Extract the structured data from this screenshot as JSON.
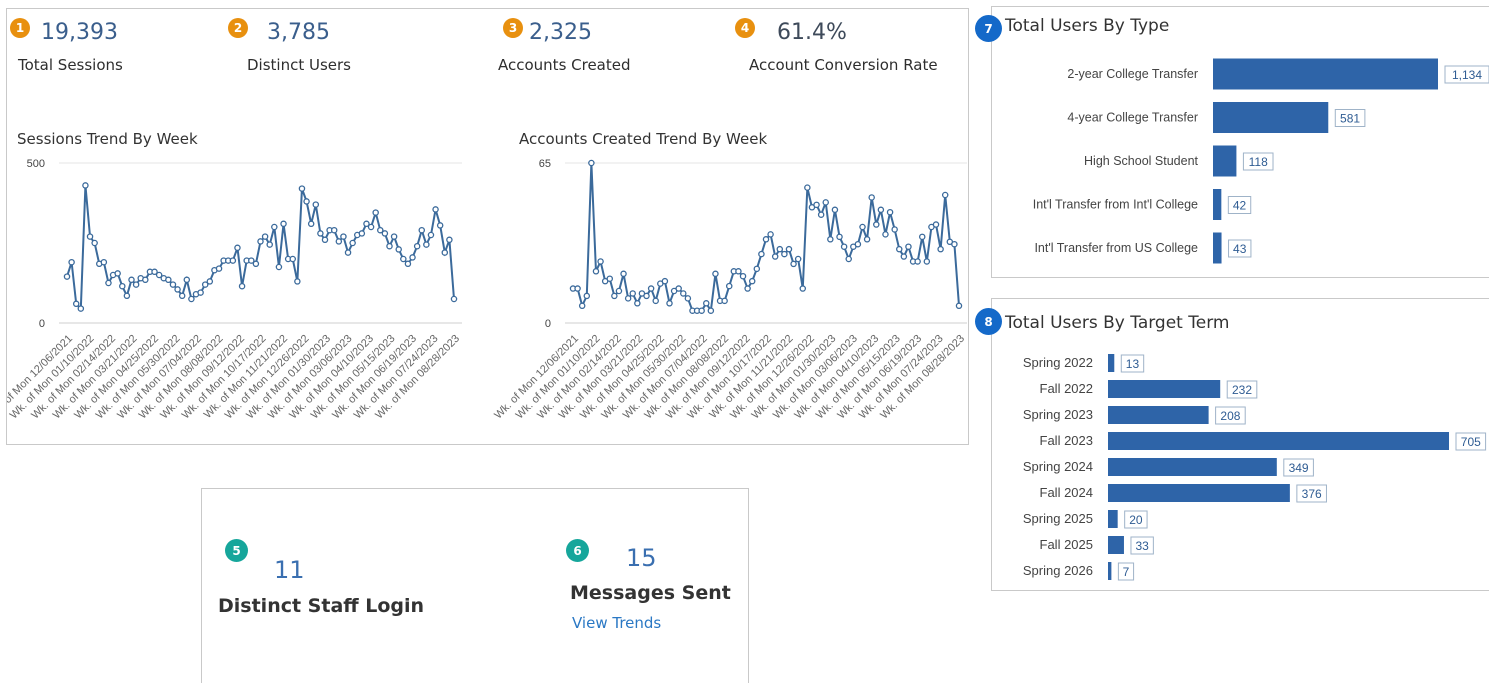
{
  "colors": {
    "accent_line": "#3b6a9b",
    "bar": "#2e64a8",
    "badge_orange": "#e8900f",
    "badge_teal": "#16a69b",
    "badge_blue": "#1469c9",
    "value_link": "#2a78c4"
  },
  "kpis": [
    {
      "badge": "1",
      "value": "19,393",
      "label": "Total Sessions"
    },
    {
      "badge": "2",
      "value": "3,785",
      "label": "Distinct Users"
    },
    {
      "badge": "3",
      "value": "2,325",
      "label": "Accounts Created"
    },
    {
      "badge": "4",
      "value": "61.4%",
      "label": "Account Conversion Rate"
    }
  ],
  "staff": {
    "login": {
      "badge": "5",
      "value": "11",
      "label": "Distinct Staff Login"
    },
    "messages": {
      "badge": "6",
      "value": "15",
      "label": "Messages Sent",
      "link": "View Trends"
    }
  },
  "users_by_type": {
    "badge": "7",
    "title": "Total Users By Type"
  },
  "users_by_term": {
    "badge": "8",
    "title": "Total Users By Target Term"
  },
  "chart_data": [
    {
      "type": "line",
      "title": "Sessions Trend By Week",
      "ylim": [
        0,
        500
      ],
      "yticks": [
        "500",
        "0"
      ],
      "xtick_labels": [
        "Wk. of Mon 12/06/2021",
        "Wk. of Mon 01/10/2022",
        "Wk. of Mon 02/14/2022",
        "Wk. of Mon 03/21/2022",
        "Wk. of Mon 04/25/2022",
        "Wk. of Mon 05/30/2022",
        "Wk. of Mon 07/04/2022",
        "Wk. of Mon 08/08/2022",
        "Wk. of Mon 09/12/2022",
        "Wk. of Mon 10/17/2022",
        "Wk. of Mon 11/21/2022",
        "Wk. of Mon 12/26/2022",
        "Wk. of Mon 01/30/2023",
        "Wk. of Mon 03/06/2023",
        "Wk. of Mon 04/10/2023",
        "Wk. of Mon 05/15/2023",
        "Wk. of Mon 06/19/2023",
        "Wk. of Mon 07/24/2023",
        "Wk. of Mon 08/28/2023"
      ],
      "values": [
        145,
        190,
        60,
        45,
        430,
        270,
        250,
        185,
        190,
        125,
        150,
        155,
        115,
        85,
        135,
        120,
        140,
        135,
        160,
        160,
        150,
        140,
        135,
        120,
        105,
        85,
        135,
        75,
        90,
        95,
        120,
        130,
        165,
        170,
        195,
        195,
        195,
        235,
        115,
        195,
        195,
        185,
        255,
        270,
        245,
        300,
        175,
        310,
        200,
        200,
        130,
        420,
        380,
        310,
        370,
        280,
        260,
        290,
        290,
        255,
        270,
        220,
        250,
        275,
        280,
        310,
        300,
        345,
        290,
        280,
        240,
        270,
        230,
        200,
        185,
        205,
        240,
        290,
        245,
        275,
        355,
        305,
        220,
        260,
        75
      ]
    },
    {
      "type": "line",
      "title": "Accounts Created Trend By Week",
      "ylim": [
        0,
        65
      ],
      "yticks": [
        "65",
        "0"
      ],
      "xtick_labels": [
        "Wk. of Mon 12/06/2021",
        "Wk. of Mon 01/10/2022",
        "Wk. of Mon 02/14/2022",
        "Wk. of Mon 03/21/2022",
        "Wk. of Mon 04/25/2022",
        "Wk. of Mon 05/30/2022",
        "Wk. of Mon 07/04/2022",
        "Wk. of Mon 08/08/2022",
        "Wk. of Mon 09/12/2022",
        "Wk. of Mon 10/17/2022",
        "Wk. of Mon 11/21/2022",
        "Wk. of Mon 12/26/2022",
        "Wk. of Mon 01/30/2023",
        "Wk. of Mon 03/06/2023",
        "Wk. of Mon 04/10/2023",
        "Wk. of Mon 05/15/2023",
        "Wk. of Mon 06/19/2023",
        "Wk. of Mon 07/24/2023",
        "Wk. of Mon 08/28/2023"
      ],
      "values": [
        14,
        14,
        7,
        11,
        65,
        21,
        25,
        17,
        18,
        11,
        13,
        20,
        10,
        12,
        8,
        12,
        11,
        14,
        9,
        16,
        17,
        8,
        13,
        14,
        12,
        10,
        5,
        5,
        5,
        8,
        5,
        20,
        9,
        9,
        15,
        21,
        21,
        19,
        14,
        17,
        22,
        28,
        34,
        36,
        27,
        30,
        28,
        30,
        24,
        26,
        14,
        55,
        47,
        48,
        44,
        49,
        34,
        46,
        35,
        31,
        26,
        31,
        32,
        39,
        34,
        51,
        40,
        46,
        36,
        45,
        38,
        30,
        27,
        31,
        25,
        25,
        35,
        25,
        39,
        40,
        30,
        52,
        33,
        32,
        7
      ]
    },
    {
      "type": "bar",
      "orientation": "horizontal",
      "title": "Total Users By Type",
      "categories": [
        "2-year College Transfer",
        "4-year College Transfer",
        "High School Student",
        "Int'l Transfer from Int'l College",
        "Int'l Transfer from US College"
      ],
      "values": [
        1134,
        581,
        118,
        42,
        43
      ],
      "value_labels": [
        "1,134",
        "581",
        "118",
        "42",
        "43"
      ]
    },
    {
      "type": "bar",
      "orientation": "horizontal",
      "title": "Total Users By Target Term",
      "categories": [
        "Spring 2022",
        "Fall 2022",
        "Spring 2023",
        "Fall 2023",
        "Spring 2024",
        "Fall 2024",
        "Spring 2025",
        "Fall 2025",
        "Spring 2026"
      ],
      "values": [
        13,
        232,
        208,
        705,
        349,
        376,
        20,
        33,
        7
      ],
      "value_labels": [
        "13",
        "232",
        "208",
        "705",
        "349",
        "376",
        "20",
        "33",
        "7"
      ]
    }
  ]
}
